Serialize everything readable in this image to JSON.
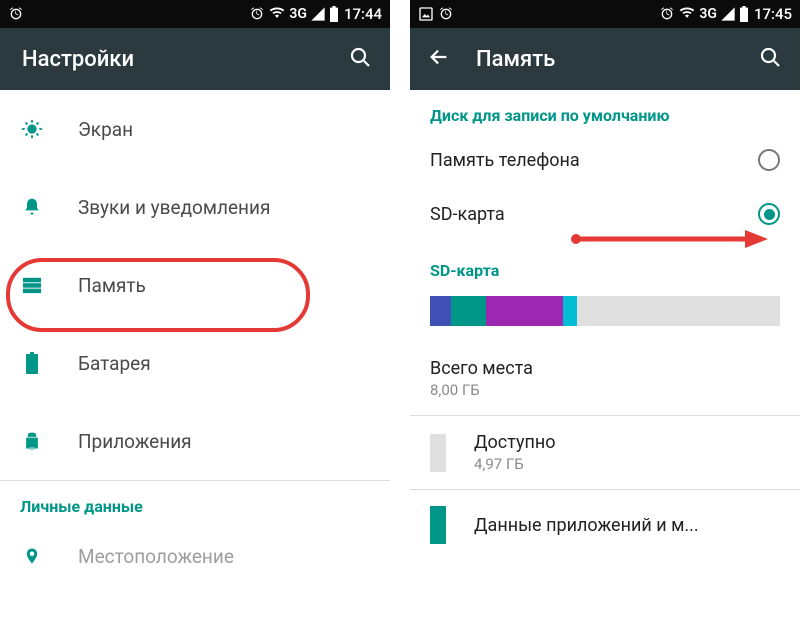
{
  "left": {
    "status": {
      "time": "17:44",
      "network": "3G"
    },
    "title": "Настройки",
    "items": [
      {
        "label": "Экран"
      },
      {
        "label": "Звуки и уведомления"
      },
      {
        "label": "Память"
      },
      {
        "label": "Батарея"
      },
      {
        "label": "Приложения"
      }
    ],
    "section": "Личные данные",
    "location": "Местоположение"
  },
  "right": {
    "status": {
      "time": "17:45",
      "network": "3G"
    },
    "title": "Память",
    "default_section": "Диск для записи по умолчанию",
    "options": [
      {
        "label": "Память телефона"
      },
      {
        "label": "SD-карта"
      }
    ],
    "sd_section": "SD-карта",
    "total_label": "Всего места",
    "total_value": "8,00 ГБ",
    "avail_label": "Доступно",
    "avail_value": "4,97 ГБ",
    "apps_label": "Данные приложений и м..."
  }
}
